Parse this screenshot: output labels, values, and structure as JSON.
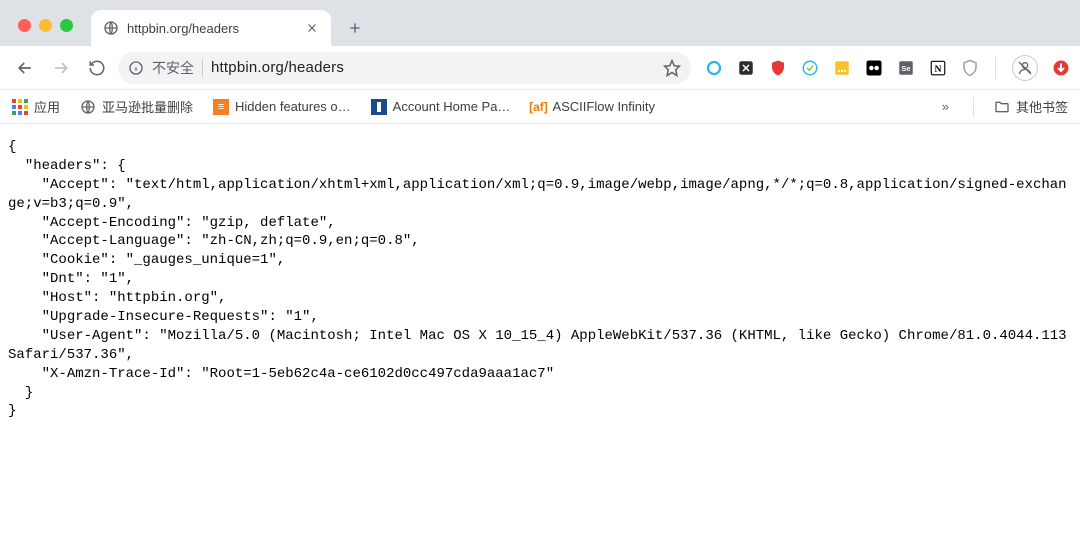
{
  "window": {
    "tab_title": "httpbin.org/headers",
    "url_text": "httpbin.org/headers",
    "security_label": "不安全"
  },
  "bookmarks": {
    "apps_label": "应用",
    "items": [
      {
        "label": "亚马逊批量删除"
      },
      {
        "label": "Hidden features o…"
      },
      {
        "label": "Account Home Pa…"
      },
      {
        "label": "ASCIIFlow Infinity"
      }
    ],
    "overflow_glyph": "»",
    "other_label": "其他书签"
  },
  "content_text": "{\n  \"headers\": {\n    \"Accept\": \"text/html,application/xhtml+xml,application/xml;q=0.9,image/webp,image/apng,*/*;q=0.8,application/signed-exchange;v=b3;q=0.9\",\n    \"Accept-Encoding\": \"gzip, deflate\",\n    \"Accept-Language\": \"zh-CN,zh;q=0.9,en;q=0.8\",\n    \"Cookie\": \"_gauges_unique=1\",\n    \"Dnt\": \"1\",\n    \"Host\": \"httpbin.org\",\n    \"Upgrade-Insecure-Requests\": \"1\",\n    \"User-Agent\": \"Mozilla/5.0 (Macintosh; Intel Mac OS X 10_15_4) AppleWebKit/537.36 (KHTML, like Gecko) Chrome/81.0.4044.113 Safari/537.36\",\n    \"X-Amzn-Trace-Id\": \"Root=1-5eb62c4a-ce6102d0cc497cda9aaa1ac7\"\n  }\n}",
  "extension_colors": {
    "circle": "#29b6f6",
    "x_box": "#2c2c2c",
    "ublock": "#e53935",
    "globe": "#29b6f6",
    "yellow": "#f9c423",
    "bw_box": "#000",
    "se_box": "#5f6368",
    "notion": "#000",
    "shield": "#9e9e9e",
    "red_arrow": "#e53935"
  }
}
